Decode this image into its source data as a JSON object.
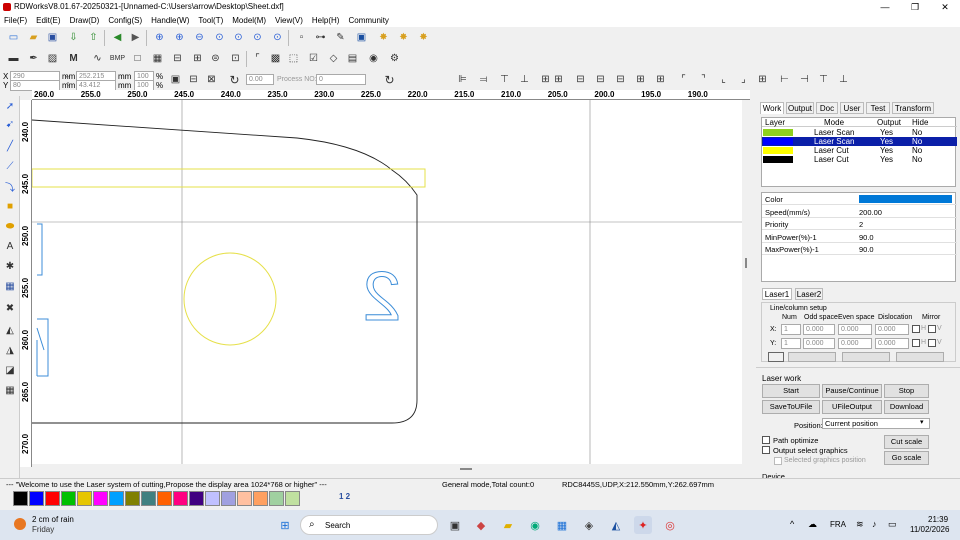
{
  "window": {
    "title": "RDWorksV8.01.67-20250321-[Unnamed-C:\\Users\\arrow\\Desktop\\Sheet.dxf]"
  },
  "menu": [
    "File(F)",
    "Edit(E)",
    "Draw(D)",
    "Config(S)",
    "Handle(W)",
    "Tool(T)",
    "Model(M)",
    "View(V)",
    "Help(H)",
    "Community"
  ],
  "coords": {
    "x_label": "X",
    "y_label": "Y",
    "x_value": "290",
    "y_value": "80",
    "unit_mm": "mm",
    "width_value": "252.215",
    "height_value": "43.412",
    "pct_x": "100",
    "pct_y": "100",
    "pct": "%",
    "rotate_value": "0.00",
    "process_no_label": "Process NO:",
    "process_no": "0"
  },
  "ruler_h": [
    "260.0",
    "255.0",
    "250.0",
    "245.0",
    "240.0",
    "235.0",
    "230.0",
    "225.0",
    "220.0",
    "215.0",
    "210.0",
    "205.0",
    "200.0",
    "195.0",
    "190.0"
  ],
  "ruler_v": [
    "240.0",
    "245.0",
    "250.0",
    "255.0",
    "260.0",
    "265.0",
    "270.0"
  ],
  "right_panel": {
    "tabs": [
      "Work",
      "Output",
      "Doc",
      "User",
      "Test",
      "Transform"
    ],
    "layer_headers": [
      "Layer",
      "Mode",
      "Output",
      "Hide"
    ],
    "layers": [
      {
        "color": "#8fd11d",
        "mode": "Laser Scan",
        "output": "Yes",
        "hide": "No",
        "selected": false
      },
      {
        "color": "#0000ff",
        "mode": "Laser Scan",
        "output": "Yes",
        "hide": "No",
        "selected": true
      },
      {
        "color": "#ffff00",
        "mode": "Laser Cut",
        "output": "Yes",
        "hide": "No",
        "selected": false
      },
      {
        "color": "#000000",
        "mode": "Laser Cut",
        "output": "Yes",
        "hide": "No",
        "selected": false
      }
    ],
    "props": [
      {
        "key": "Color",
        "value": ""
      },
      {
        "key": "Speed(mm/s)",
        "value": "200.00"
      },
      {
        "key": "Priority",
        "value": "2"
      },
      {
        "key": "MinPower(%)-1",
        "value": "90.0"
      },
      {
        "key": "MaxPower(%)-1",
        "value": "90.0"
      }
    ],
    "prop_color": "#0078d7",
    "laser_tabs": [
      "Laser1",
      "Laser2"
    ],
    "linecol": {
      "title": "Line/column setup",
      "headers": [
        "Num",
        "Odd space",
        "Even space",
        "Dislocation",
        "Mirror"
      ],
      "x_label": "X:",
      "y_label": "Y:",
      "x_values": [
        "1",
        "0.000",
        "0.000",
        "0.000"
      ],
      "y_values": [
        "1",
        "0.000",
        "0.000",
        "0.000"
      ],
      "mirror_h": "H",
      "mirror_v": "V"
    }
  },
  "laser_work": {
    "title": "Laser work",
    "buttons": [
      "Start",
      "Pause/Continue",
      "Stop",
      "SaveToUFile",
      "UFileOutput",
      "Download"
    ],
    "position_label": "Position:",
    "position_value": "Current position",
    "path_optimize": "Path optimize",
    "output_select": "Output select graphics",
    "selected_pos": "Selected graphics position",
    "cut_scale": "Cut scale",
    "go_scale": "Go scale",
    "device": "Device"
  },
  "status": {
    "welcome": "--- \"Welcome to use the Laser system of cutting,Propose the display area 1024*768 or higher\" ---",
    "mode": "General mode,Total count:0",
    "device": "RDC8445S,UDP,X:212.550mm,Y:262.697mm"
  },
  "palette": [
    "#000000",
    "#0000ff",
    "#ff0000",
    "#00c000",
    "#e6c600",
    "#ff00ff",
    "#00a0ff",
    "#808000",
    "#408080",
    "#ff6000",
    "#ff0080",
    "#400080",
    "#c0c0ff",
    "#a0a0e0",
    "#ffc0a0",
    "#ffa060",
    "#a0d0a0",
    "#c0e0a0"
  ],
  "palette_more": "1 2",
  "taskbar": {
    "weather": "2 cm of rain",
    "weather_sub": "Friday",
    "search": "Search",
    "lang": "FRA",
    "time": "21:39",
    "date": "11/02/2026"
  },
  "canvas_text": "2"
}
